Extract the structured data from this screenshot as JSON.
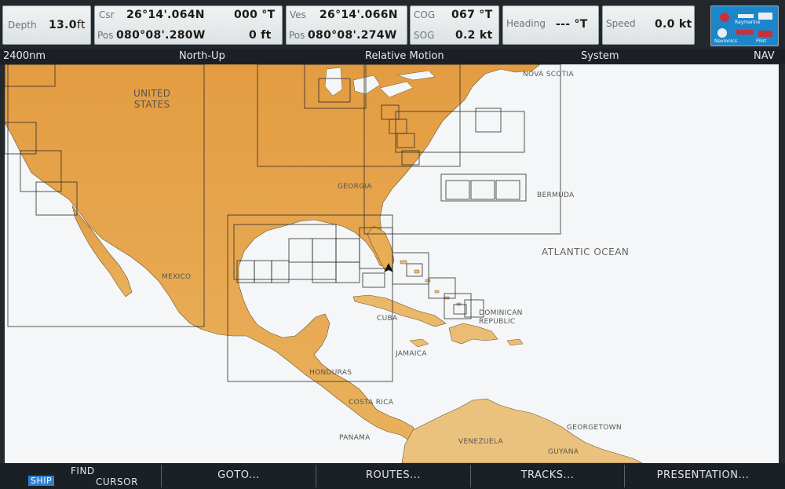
{
  "databar": {
    "depth": {
      "label": "Depth",
      "value": "13.0",
      "unit": "ft"
    },
    "cursor": {
      "label": "Csr",
      "lat": "26°14'.064N",
      "bearing": "000 °T",
      "pos_label": "Pos",
      "lon": "080°08'.280W",
      "range": "0 ft"
    },
    "vessel": {
      "label": "Ves",
      "lat": "26°14'.066N",
      "pos_label": "Pos",
      "lon": "080°08'.274W"
    },
    "cog": {
      "label": "COG",
      "value": "067 °T"
    },
    "sog": {
      "label": "SOG",
      "value": "0.2 kt"
    },
    "heading": {
      "label": "Heading",
      "value": "--- °T"
    },
    "speed": {
      "label": "Speed",
      "value": "0.0 kt"
    },
    "logo": {
      "lines": [
        "Raymarine",
        "Navionics",
        "Pilot"
      ]
    }
  },
  "statusbar": {
    "scale": "2400nm",
    "orientation": "North-Up",
    "motion": "Relative Motion",
    "mode": "System",
    "nav": "NAV"
  },
  "map": {
    "places": {
      "united_states": "UNITED\nSTATES",
      "mexico": "MEXICO",
      "georgia": "GEORGIA",
      "nova_scotia": "NOVA SCOTIA",
      "bermuda": "BERMUDA",
      "atlantic": "ATLANTIC OCEAN",
      "cuba": "CUBA",
      "dominican": "DOMINICAN\nREPUBLIC",
      "jamaica": "JAMAICA",
      "honduras": "HONDURAS",
      "costa_rica": "COSTA RICA",
      "panama": "PANAMA",
      "venezuela": "VENEZUELA",
      "georgetown": "GEORGETOWN",
      "guyana": "GUYANA"
    },
    "colors": {
      "land": "#e8a64a",
      "land_south": "#ebc27d",
      "water": "#f4f6f7",
      "chart_outline": "#2d2d2d"
    }
  },
  "softkeys": {
    "ship": "SHIP",
    "find_cursor_1": "FIND",
    "find_cursor_2": "CURSOR",
    "goto": "GOTO...",
    "routes": "ROUTES...",
    "tracks": "TRACKS...",
    "presentation": "PRESENTATION..."
  }
}
